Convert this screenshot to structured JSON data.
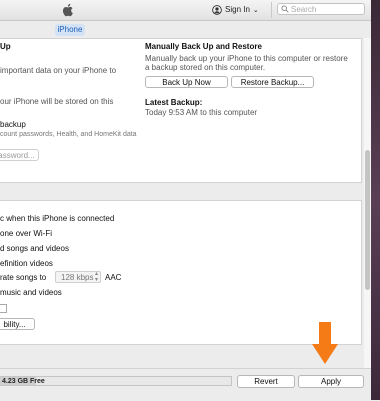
{
  "header": {
    "sign_in_label": "Sign In",
    "search_placeholder": "Search",
    "device_tab_label": "iPhone"
  },
  "backup": {
    "left_title_fragment": "Up",
    "left_line1": "important data on your iPhone to",
    "left_line2": "our iPhone will be stored on this",
    "encrypt_label": "backup",
    "encrypt_desc": "count passwords, Health, and HomeKit data",
    "change_password_btn": "assword...",
    "manual_title": "Manually Back Up and Restore",
    "manual_desc_line1": "Manually back up your iPhone to this computer or restore",
    "manual_desc_line2": "a backup stored on this computer.",
    "back_up_now_btn": "Back Up Now",
    "restore_backup_btn": "Restore Backup...",
    "latest_label": "Latest Backup:",
    "latest_value": "Today 9:53 AM to this computer"
  },
  "options": {
    "item1": "c when this iPhone is connected",
    "item2": "one over Wi-Fi",
    "item3": "d songs and videos",
    "item4": "efinition videos",
    "item5_prefix": "rate songs to",
    "bitrate_value": "128 kbps",
    "bitrate_format": "AAC",
    "item6": "music and videos",
    "accessibility_btn": "bility..."
  },
  "footer": {
    "storage_label": "4.23 GB Free",
    "revert_btn": "Revert",
    "apply_btn": "Apply"
  },
  "colors": {
    "accent": "#1b5fb7",
    "arrow": "#f47b16",
    "tab_bg": "#d3e2f5"
  },
  "icons": [
    "apple-logo-icon",
    "avatar-icon",
    "chevron-down-icon",
    "search-icon",
    "stepper-icon",
    "arrow-down-icon"
  ]
}
